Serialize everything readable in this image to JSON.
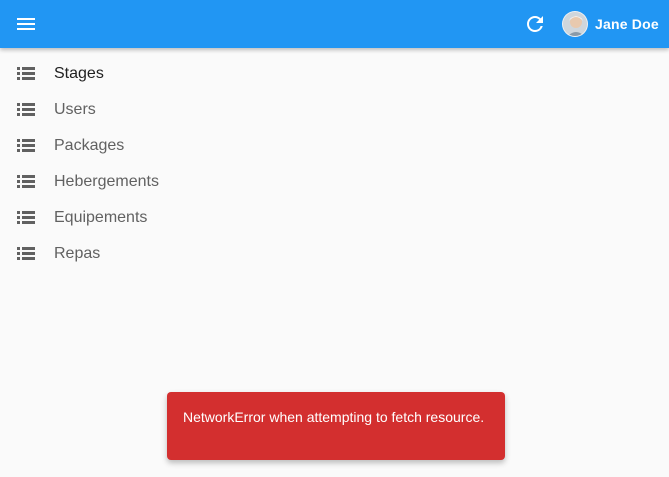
{
  "header": {
    "menu_icon": "menu-icon",
    "refresh_icon": "refresh-icon",
    "user_name": "Jane Doe",
    "background_color": "#2196f3"
  },
  "sidebar": {
    "items": [
      {
        "label": "Stages",
        "icon": "list-icon",
        "active": true
      },
      {
        "label": "Users",
        "icon": "list-icon"
      },
      {
        "label": "Packages",
        "icon": "list-icon"
      },
      {
        "label": "Hebergements",
        "icon": "list-icon"
      },
      {
        "label": "Equipements",
        "icon": "list-icon"
      },
      {
        "label": "Repas",
        "icon": "list-icon"
      }
    ]
  },
  "notification": {
    "message": "NetworkError when attempting to fetch resource.",
    "color": "#d32f2f"
  }
}
